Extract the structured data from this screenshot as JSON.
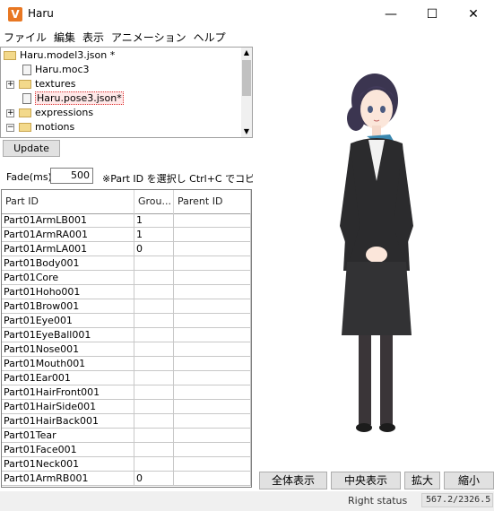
{
  "window": {
    "title": "Haru",
    "icon_glyph": "V",
    "icon_color": "#e87722",
    "minimize_glyph": "—",
    "maximize_glyph": "☐",
    "close_glyph": "✕"
  },
  "menu": [
    "ファイル",
    "編集",
    "表示",
    "アニメーション",
    "ヘルプ"
  ],
  "tree": {
    "items": [
      {
        "label": "Haru.model3.json *",
        "icon": "folder-icon"
      },
      {
        "label": "Haru.moc3",
        "icon": "file-icon"
      },
      {
        "label": "textures",
        "icon": "folder-icon"
      },
      {
        "label": "Haru.pose3.json*",
        "icon": "file-icon"
      },
      {
        "label": "expressions",
        "icon": "folder-icon"
      },
      {
        "label": "motions",
        "icon": "folder-icon"
      }
    ]
  },
  "update_label": "Update",
  "fade": {
    "label": "Fade(ms)",
    "value": "500"
  },
  "hint": "※Part ID を選択し Ctrl+C でコピー",
  "grid": {
    "headers": [
      "Part ID",
      "Grou...",
      "Parent ID"
    ],
    "rows": [
      [
        "Part01ArmLB001",
        "1",
        ""
      ],
      [
        "Part01ArmRA001",
        "1",
        ""
      ],
      [
        "Part01ArmLA001",
        "0",
        ""
      ],
      [
        "Part01Body001",
        "",
        ""
      ],
      [
        "Part01Core",
        "",
        ""
      ],
      [
        "Part01Hoho001",
        "",
        ""
      ],
      [
        "Part01Brow001",
        "",
        ""
      ],
      [
        "Part01Eye001",
        "",
        ""
      ],
      [
        "Part01EyeBall001",
        "",
        ""
      ],
      [
        "Part01Nose001",
        "",
        ""
      ],
      [
        "Part01Mouth001",
        "",
        ""
      ],
      [
        "Part01Ear001",
        "",
        ""
      ],
      [
        "Part01HairFront001",
        "",
        ""
      ],
      [
        "Part01HairSide001",
        "",
        ""
      ],
      [
        "Part01HairBack001",
        "",
        ""
      ],
      [
        "Part01Tear",
        "",
        ""
      ],
      [
        "Part01Face001",
        "",
        ""
      ],
      [
        "Part01Neck001",
        "",
        ""
      ],
      [
        "Part01ArmRB001",
        "0",
        ""
      ]
    ]
  },
  "view_buttons": [
    "全体表示",
    "中央表示",
    "拡大",
    "縮小"
  ],
  "status": {
    "text": "Right status",
    "coords": "567.2/2326.5"
  }
}
